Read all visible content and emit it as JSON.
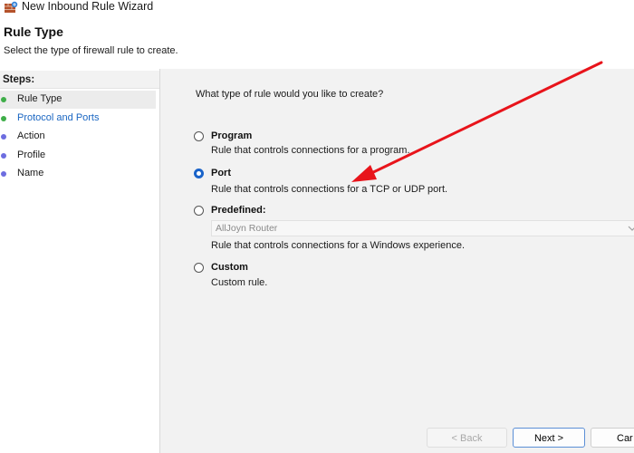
{
  "window": {
    "title": "New Inbound Rule Wizard"
  },
  "header": {
    "title": "Rule Type",
    "subtitle": "Select the type of firewall rule to create."
  },
  "steps": {
    "heading": "Steps:",
    "items": [
      {
        "label": "Rule Type",
        "color": "#3fae49"
      },
      {
        "label": "Protocol and Ports",
        "color": "#3fae49"
      },
      {
        "label": "Action",
        "color": "#6d6de0"
      },
      {
        "label": "Profile",
        "color": "#6d6de0"
      },
      {
        "label": "Name",
        "color": "#6d6de0"
      }
    ]
  },
  "main": {
    "question": "What type of rule would you like to create?",
    "options": [
      {
        "label": "Program",
        "description": "Rule that controls connections for a program.",
        "checked": false
      },
      {
        "label": "Port",
        "description": "Rule that controls connections for a TCP or UDP port.",
        "checked": true
      },
      {
        "label": "Predefined:",
        "dropdown_value": "AllJoyn Router",
        "description": "Rule that controls connections for a Windows experience.",
        "checked": false
      },
      {
        "label": "Custom",
        "description": "Custom rule.",
        "checked": false
      }
    ]
  },
  "buttons": {
    "back": "< Back",
    "next": "Next >",
    "cancel": "Car"
  },
  "colors": {
    "accent": "#1a63c9",
    "annotation_arrow": "#e8141b",
    "link_active": "#1a66c2"
  }
}
